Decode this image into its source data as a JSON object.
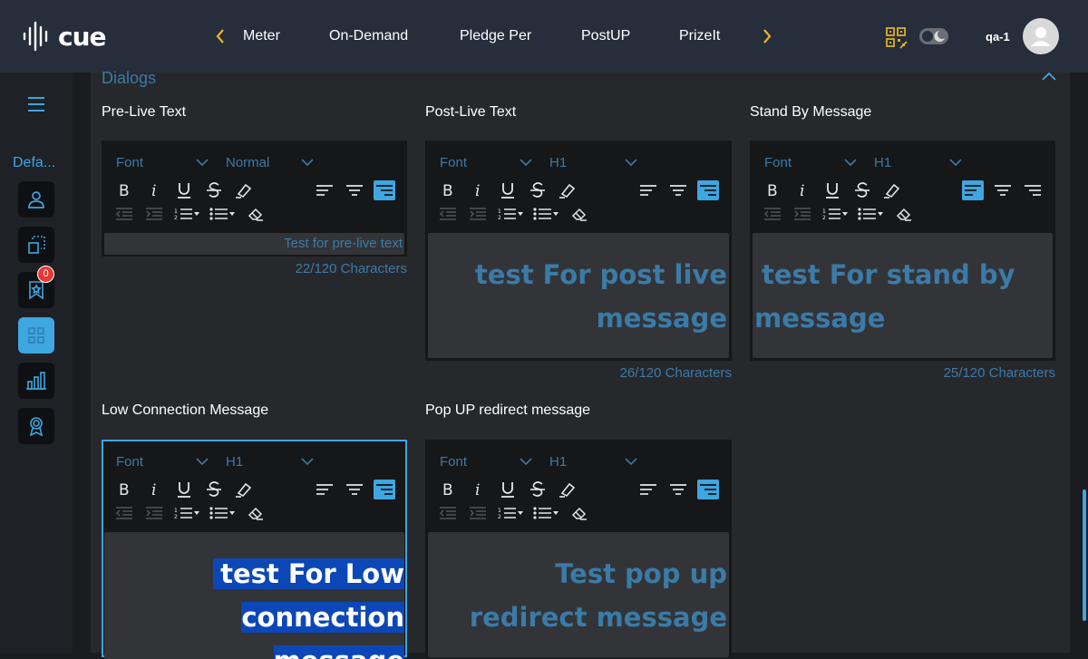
{
  "header": {
    "logo_text": "cue",
    "nav": [
      "Meter",
      "On-Demand",
      "Pledge Per",
      "PostUP",
      "PrizeIt"
    ],
    "user_name": "qa-1"
  },
  "sidebar": {
    "label": "Defa...",
    "notification_count": "0"
  },
  "section": {
    "title": "Dialogs"
  },
  "editors": [
    {
      "label": "Pre-Live Text",
      "font": "Font",
      "heading": "Normal",
      "text": "Test for pre-live text",
      "count": "22/120 Characters"
    },
    {
      "label": "Post-Live Text",
      "font": "Font",
      "heading": "H1",
      "text": "test For post live message",
      "count": "26/120 Characters"
    },
    {
      "label": "Stand By Message",
      "font": "Font",
      "heading": "H1",
      "text": "test For stand by message",
      "count": "25/120 Characters"
    },
    {
      "label": "Low Connection Message",
      "font": "Font",
      "heading": "H1",
      "text_line1": "test For Low",
      "text_line2": "connection message"
    },
    {
      "label": "Pop UP redirect message",
      "font": "Font",
      "heading": "H1",
      "text": "Test pop up redirect message"
    }
  ],
  "colors": {
    "accent": "#3ea6e0",
    "muted_blue": "#3a7ba8",
    "selection": "#0c47b7",
    "header_bg": "#262d3b",
    "qr_icon": "#e0b020",
    "badge": "#e53935"
  }
}
